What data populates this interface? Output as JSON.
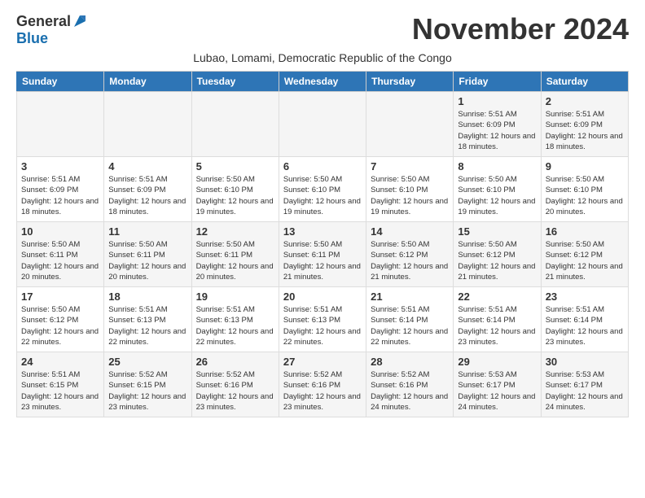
{
  "header": {
    "logo_general": "General",
    "logo_blue": "Blue",
    "month_title": "November 2024",
    "location": "Lubao, Lomami, Democratic Republic of the Congo"
  },
  "weekdays": [
    "Sunday",
    "Monday",
    "Tuesday",
    "Wednesday",
    "Thursday",
    "Friday",
    "Saturday"
  ],
  "weeks": [
    [
      {
        "day": "",
        "info": ""
      },
      {
        "day": "",
        "info": ""
      },
      {
        "day": "",
        "info": ""
      },
      {
        "day": "",
        "info": ""
      },
      {
        "day": "",
        "info": ""
      },
      {
        "day": "1",
        "info": "Sunrise: 5:51 AM\nSunset: 6:09 PM\nDaylight: 12 hours and 18 minutes."
      },
      {
        "day": "2",
        "info": "Sunrise: 5:51 AM\nSunset: 6:09 PM\nDaylight: 12 hours and 18 minutes."
      }
    ],
    [
      {
        "day": "3",
        "info": "Sunrise: 5:51 AM\nSunset: 6:09 PM\nDaylight: 12 hours and 18 minutes."
      },
      {
        "day": "4",
        "info": "Sunrise: 5:51 AM\nSunset: 6:09 PM\nDaylight: 12 hours and 18 minutes."
      },
      {
        "day": "5",
        "info": "Sunrise: 5:50 AM\nSunset: 6:10 PM\nDaylight: 12 hours and 19 minutes."
      },
      {
        "day": "6",
        "info": "Sunrise: 5:50 AM\nSunset: 6:10 PM\nDaylight: 12 hours and 19 minutes."
      },
      {
        "day": "7",
        "info": "Sunrise: 5:50 AM\nSunset: 6:10 PM\nDaylight: 12 hours and 19 minutes."
      },
      {
        "day": "8",
        "info": "Sunrise: 5:50 AM\nSunset: 6:10 PM\nDaylight: 12 hours and 19 minutes."
      },
      {
        "day": "9",
        "info": "Sunrise: 5:50 AM\nSunset: 6:10 PM\nDaylight: 12 hours and 20 minutes."
      }
    ],
    [
      {
        "day": "10",
        "info": "Sunrise: 5:50 AM\nSunset: 6:11 PM\nDaylight: 12 hours and 20 minutes."
      },
      {
        "day": "11",
        "info": "Sunrise: 5:50 AM\nSunset: 6:11 PM\nDaylight: 12 hours and 20 minutes."
      },
      {
        "day": "12",
        "info": "Sunrise: 5:50 AM\nSunset: 6:11 PM\nDaylight: 12 hours and 20 minutes."
      },
      {
        "day": "13",
        "info": "Sunrise: 5:50 AM\nSunset: 6:11 PM\nDaylight: 12 hours and 21 minutes."
      },
      {
        "day": "14",
        "info": "Sunrise: 5:50 AM\nSunset: 6:12 PM\nDaylight: 12 hours and 21 minutes."
      },
      {
        "day": "15",
        "info": "Sunrise: 5:50 AM\nSunset: 6:12 PM\nDaylight: 12 hours and 21 minutes."
      },
      {
        "day": "16",
        "info": "Sunrise: 5:50 AM\nSunset: 6:12 PM\nDaylight: 12 hours and 21 minutes."
      }
    ],
    [
      {
        "day": "17",
        "info": "Sunrise: 5:50 AM\nSunset: 6:12 PM\nDaylight: 12 hours and 22 minutes."
      },
      {
        "day": "18",
        "info": "Sunrise: 5:51 AM\nSunset: 6:13 PM\nDaylight: 12 hours and 22 minutes."
      },
      {
        "day": "19",
        "info": "Sunrise: 5:51 AM\nSunset: 6:13 PM\nDaylight: 12 hours and 22 minutes."
      },
      {
        "day": "20",
        "info": "Sunrise: 5:51 AM\nSunset: 6:13 PM\nDaylight: 12 hours and 22 minutes."
      },
      {
        "day": "21",
        "info": "Sunrise: 5:51 AM\nSunset: 6:14 PM\nDaylight: 12 hours and 22 minutes."
      },
      {
        "day": "22",
        "info": "Sunrise: 5:51 AM\nSunset: 6:14 PM\nDaylight: 12 hours and 23 minutes."
      },
      {
        "day": "23",
        "info": "Sunrise: 5:51 AM\nSunset: 6:14 PM\nDaylight: 12 hours and 23 minutes."
      }
    ],
    [
      {
        "day": "24",
        "info": "Sunrise: 5:51 AM\nSunset: 6:15 PM\nDaylight: 12 hours and 23 minutes."
      },
      {
        "day": "25",
        "info": "Sunrise: 5:52 AM\nSunset: 6:15 PM\nDaylight: 12 hours and 23 minutes."
      },
      {
        "day": "26",
        "info": "Sunrise: 5:52 AM\nSunset: 6:16 PM\nDaylight: 12 hours and 23 minutes."
      },
      {
        "day": "27",
        "info": "Sunrise: 5:52 AM\nSunset: 6:16 PM\nDaylight: 12 hours and 23 minutes."
      },
      {
        "day": "28",
        "info": "Sunrise: 5:52 AM\nSunset: 6:16 PM\nDaylight: 12 hours and 24 minutes."
      },
      {
        "day": "29",
        "info": "Sunrise: 5:53 AM\nSunset: 6:17 PM\nDaylight: 12 hours and 24 minutes."
      },
      {
        "day": "30",
        "info": "Sunrise: 5:53 AM\nSunset: 6:17 PM\nDaylight: 12 hours and 24 minutes."
      }
    ]
  ]
}
